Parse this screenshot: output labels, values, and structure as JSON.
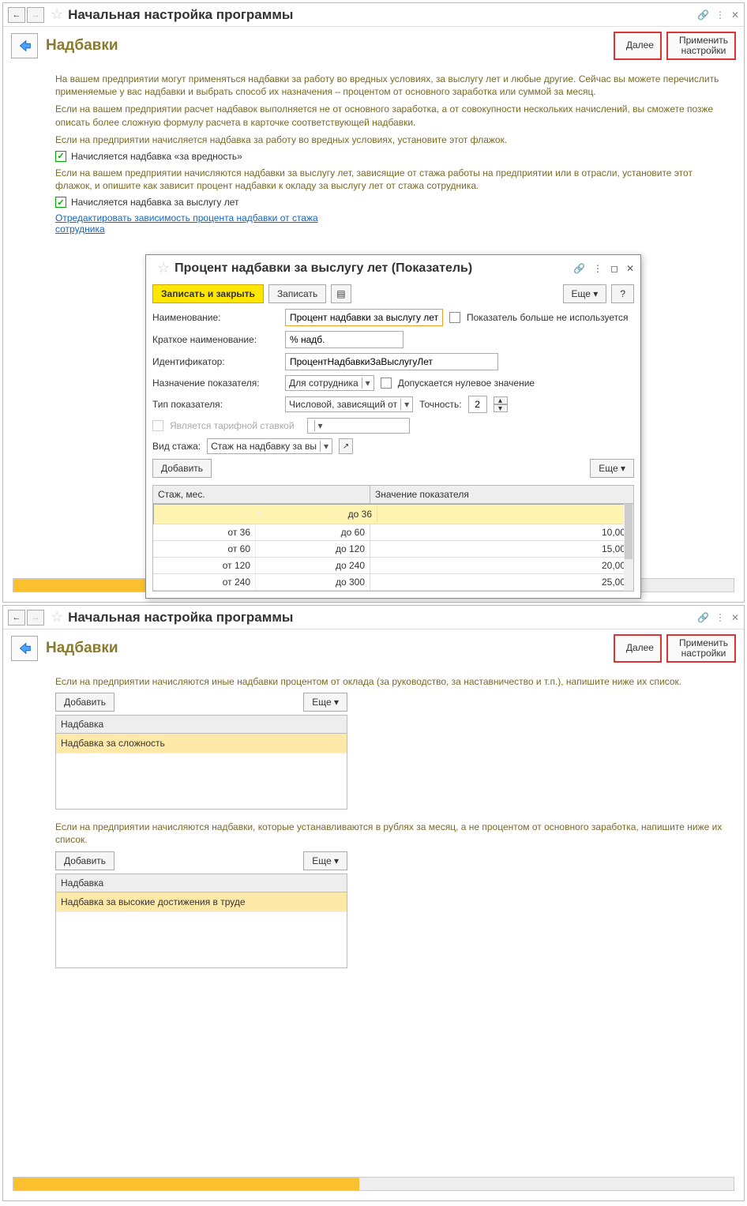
{
  "screen1": {
    "title": "Начальная настройка программы",
    "subtitle": "Надбавки",
    "btn_next": "Далее",
    "btn_apply": "Применить\nнастройки",
    "p1": "На вашем предприятии могут применяться надбавки за работу во вредных условиях, за выслугу лет и любые другие. Сейчас вы можете перечислить применяемые у вас надбавки и выбрать способ их назначения – процентом от основного заработка или суммой за месяц.",
    "p2": "Если на вашем предприятии расчет надбавок выполняется не от основного заработка, а от совокупности нескольких начислений, вы сможете позже описать более сложную формулу расчета в карточке соответствующей надбавки.",
    "p3": "Если на предприятии начисляется надбавка за работу во вредных условиях, установите этот флажок.",
    "chk1": "Начисляется надбавка «за вредность»",
    "p4": "Если на вашем предприятии начисляются надбавки за выслугу лет, зависящие от стажа работы на предприятии или в отрасли, установите этот флажок, и опишите как зависит процент надбавки к окладу за выслугу лет от стажа сотрудника.",
    "chk2": "Начисляется надбавка за выслугу лет",
    "link": "Отредактировать зависимость процента надбавки от стажа сотрудника"
  },
  "modal": {
    "title": "Процент надбавки за выслугу лет (Показатель)",
    "btn_save_close": "Записать и закрыть",
    "btn_save": "Записать",
    "btn_more": "Еще",
    "btn_help": "?",
    "lbl_name": "Наименование:",
    "val_name": "Процент надбавки за выслугу лет",
    "chk_unused": "Показатель больше не используется",
    "lbl_short": "Краткое наименование:",
    "val_short": "% надб.",
    "lbl_id": "Идентификатор:",
    "val_id": "ПроцентНадбавкиЗаВыслугуЛет",
    "lbl_purpose": "Назначение показателя:",
    "val_purpose": "Для сотрудника",
    "chk_zero": "Допускается нулевое значение",
    "lbl_type": "Тип показателя:",
    "val_type": "Числовой, зависящий от",
    "lbl_precision": "Точность:",
    "val_precision": "2",
    "chk_tariff": "Является тарифной ставкой",
    "lbl_seniority": "Вид стажа:",
    "val_seniority": "Стаж на надбавку за вы",
    "btn_add": "Добавить",
    "col1": "Стаж, мес.",
    "col2": "Значение показателя",
    "rows": [
      {
        "from": "",
        "to": "до 36",
        "val": ""
      },
      {
        "from": "от 36",
        "to": "до 60",
        "val": "10,00"
      },
      {
        "from": "от 60",
        "to": "до 120",
        "val": "15,00"
      },
      {
        "from": "от 120",
        "to": "до 240",
        "val": "20,00"
      },
      {
        "from": "от 240",
        "to": "до 300",
        "val": "25,00"
      }
    ]
  },
  "screen2": {
    "title": "Начальная настройка программы",
    "subtitle": "Надбавки",
    "btn_next": "Далее",
    "btn_apply": "Применить\nнастройки",
    "p1": "Если на предприятии начисляются иные надбавки процентом от оклада (за руководство, за наставничество и т.п.), напишите ниже их список.",
    "btn_add": "Добавить",
    "btn_more": "Еще",
    "col": "Надбавка",
    "row1": "Надбавка за сложность",
    "p2": "Если на предприятии начисляются надбавки, которые устанавливаются в рублях за месяц, а не процентом от основного заработка, напишите ниже их список.",
    "row2": "Надбавка за высокие достижения в труде"
  }
}
